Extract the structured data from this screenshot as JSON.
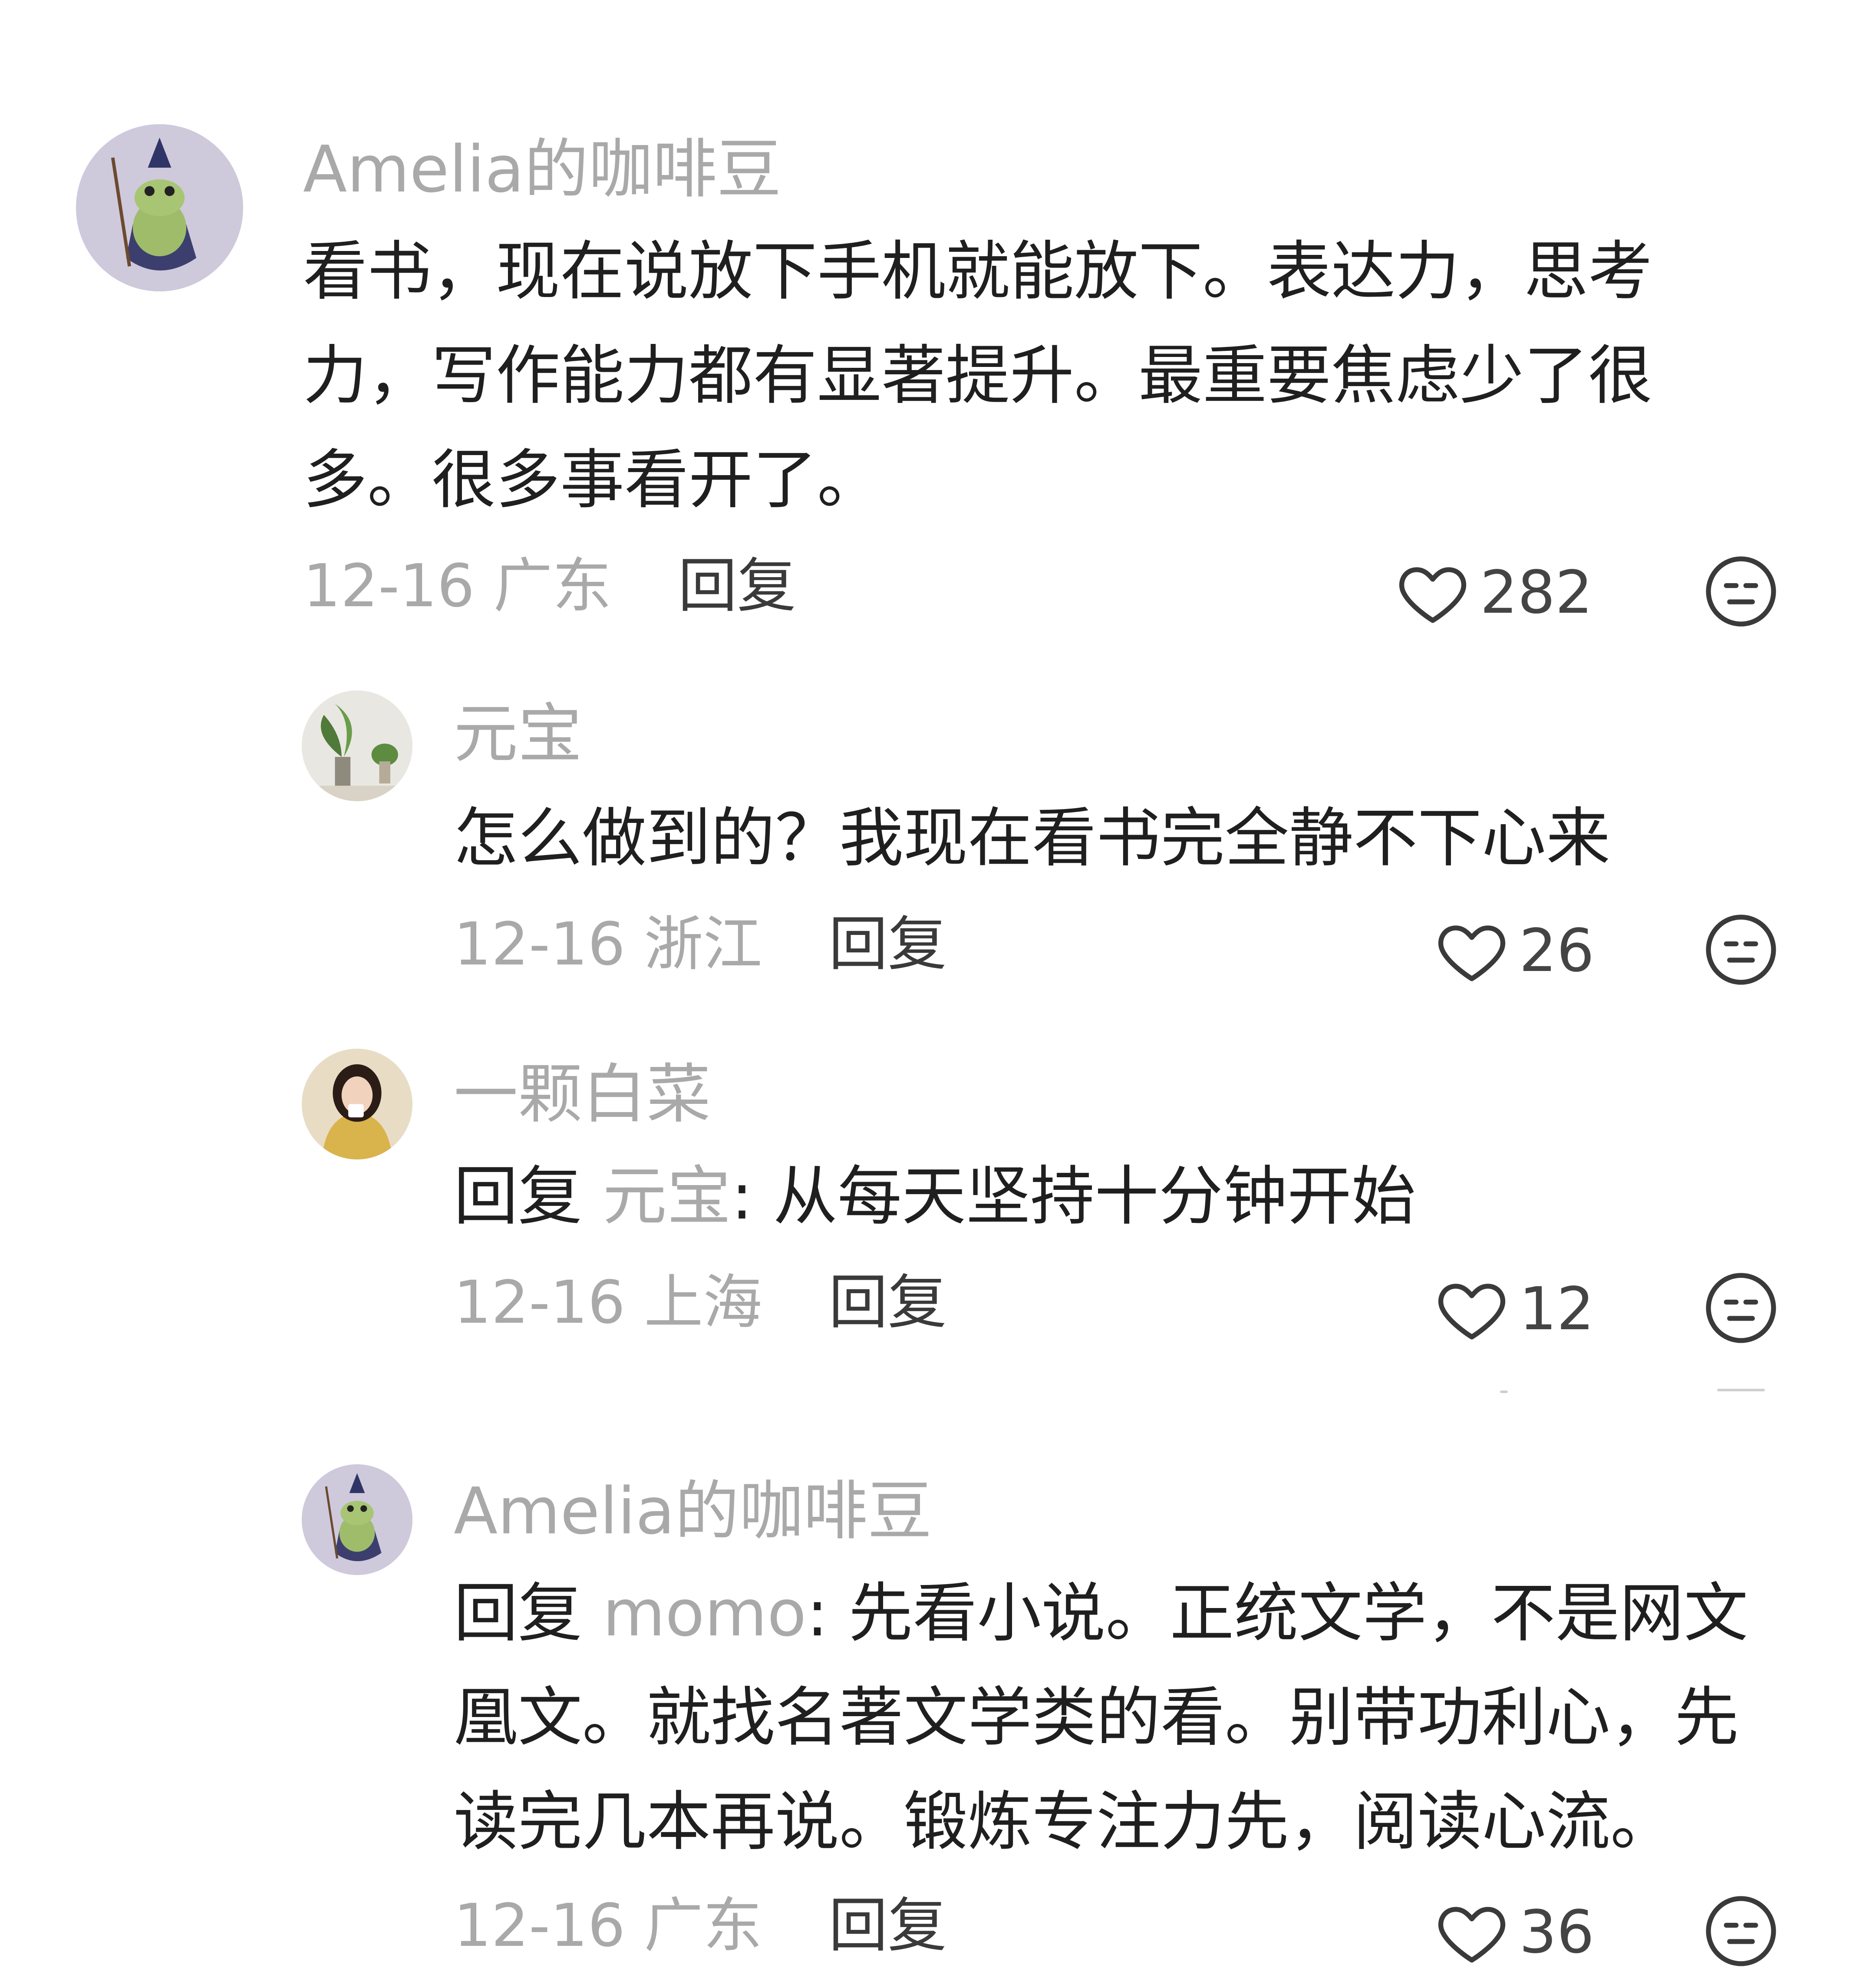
{
  "comments": [
    {
      "username": "Amelia的咖啡豆",
      "lines": [
        "看书，现在说放下手机就能放下。表达力，思考",
        "力，写作能力都有显著提升。最重要焦虑少了很",
        "多。很多事看开了。"
      ],
      "date": "12-16",
      "location": "广东",
      "reply_label": "回复",
      "likes": "282",
      "avatar_icon": "frog-wizard-avatar-icon"
    },
    {
      "username": "元宝",
      "lines": [
        "怎么做到的？我现在看书完全静不下心来"
      ],
      "date": "12-16",
      "location": "浙江",
      "reply_label": "回复",
      "likes": "26",
      "avatar_icon": "plant-decor-avatar-icon"
    },
    {
      "username": "一颗白菜",
      "reply_prefix": "回复",
      "reply_to": "元宝",
      "lines": [
        ": 从每天坚持十分钟开始"
      ],
      "date": "12-16",
      "location": "上海",
      "reply_label": "回复",
      "likes": "12",
      "avatar_icon": "woman-drinking-avatar-icon"
    },
    {
      "username": "Amelia的咖啡豆",
      "reply_prefix": "回复",
      "reply_to": "momo",
      "lines": [
        ": 先看小说。正统文学，不是网文",
        "凰文。就找名著文学类的看。别带功利心，先",
        "读完几本再说。锻炼专注力先，阅读心流。"
      ],
      "date": "12-16",
      "location": "广东",
      "reply_label": "回复",
      "likes": "36",
      "avatar_icon": "frog-wizard-avatar-icon"
    }
  ],
  "icons": {
    "like": "heart-icon",
    "dislike": "meh-face-icon"
  },
  "colors": {
    "text": "#1f1f1f",
    "muted": "#a9a9a9",
    "reply": "#3a3a3a"
  }
}
